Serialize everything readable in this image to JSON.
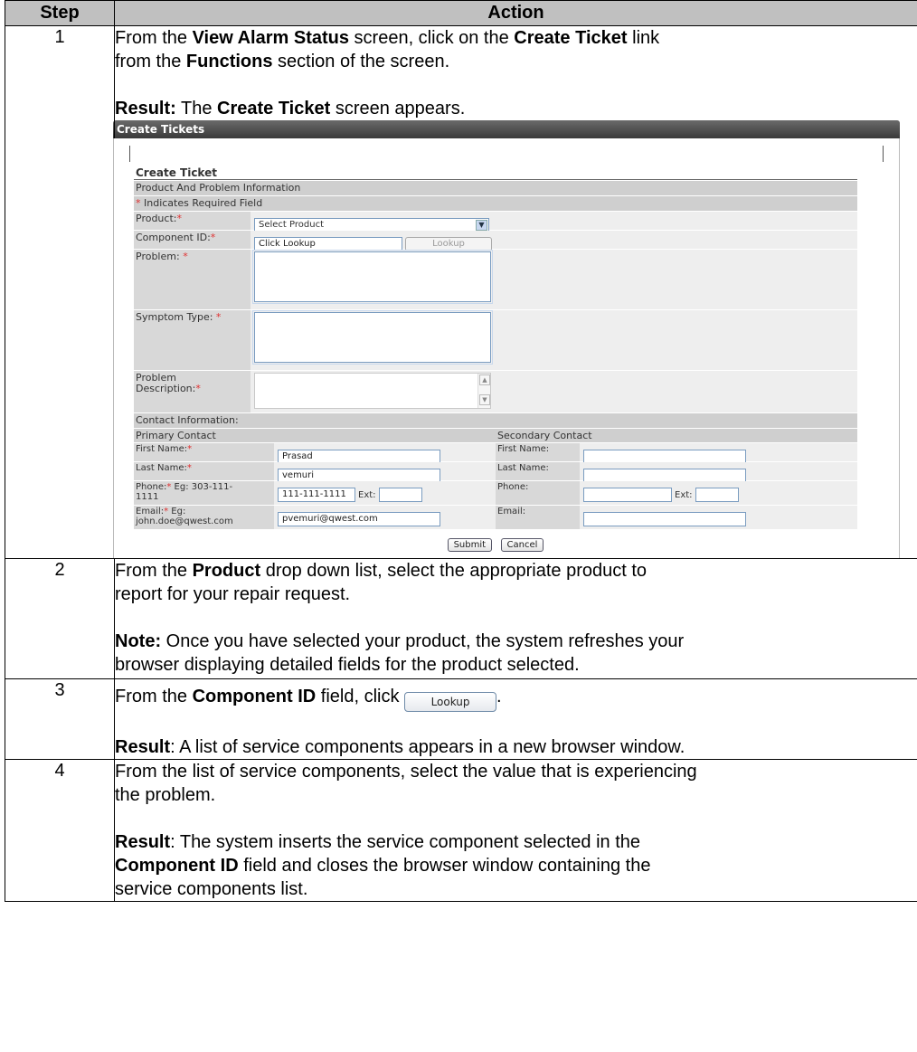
{
  "table": {
    "col_step": "Step",
    "col_action": "Action"
  },
  "steps": [
    {
      "num": "1",
      "line1_a": "From the ",
      "line1_b": "View Alarm Status",
      "line1_c": " screen, click on the ",
      "line1_d": "Create Ticket",
      "line1_e": " link",
      "line2_a": "from the ",
      "line2_b": "Functions",
      "line2_c": " section of the screen.",
      "result_label": "Result:",
      "result_a": " The ",
      "result_b": "Create Ticket",
      "result_c": " screen appears."
    },
    {
      "num": "2",
      "line1_a": "From the ",
      "line1_b": "Product",
      "line1_c": " drop down list, select the appropriate product to",
      "line2": "report for your repair request.",
      "note_label": "Note:",
      "note_text": "  Once you have selected your product, the system refreshes your",
      "note_text2": "browser displaying detailed fields for the product selected."
    },
    {
      "num": "3",
      "line1_a": "From the ",
      "line1_b": "Component ID",
      "line1_c": " field, click ",
      "line1_d": ".",
      "button": "Lookup",
      "result_label": "Result",
      "result_text": ":  A list of service components appears in a new browser window."
    },
    {
      "num": "4",
      "line1": "From the list of service components, select the value that is experiencing",
      "line2": "the problem.",
      "result_label": "Result",
      "result_text": ":  The system inserts the service component selected in the",
      "result_b": "Component ID",
      "result_c": " field and closes the browser window containing the",
      "result_d": "service components list."
    }
  ],
  "screenshot": {
    "window_title": "Create Tickets",
    "form_title": "Create Ticket",
    "section_product": "Product And Problem Information",
    "required_star": "*",
    "required_note": " Indicates Required Field",
    "product_label": "Product:",
    "product_value": "Select Product",
    "component_label": "Component ID:",
    "component_value": "Click Lookup",
    "lookup_button": "Lookup",
    "problem_label": "Problem: ",
    "symptom_label": "Symptom Type: ",
    "desc_label_1": "Problem",
    "desc_label_2": "Description:",
    "section_contact": "Contact Information:",
    "primary_contact": "Primary Contact",
    "secondary_contact": "Secondary Contact",
    "first_name": "First Name:",
    "last_name": "Last Name:",
    "phone_label": "Phone:",
    "phone_eg_1": " Eg: 303-111-",
    "phone_eg_2": "1111",
    "email_label": "Email:",
    "email_eg_1": " Eg:",
    "email_eg_2": "john.doe@qwest.com",
    "first_value": "Prasad",
    "last_value": "vemuri",
    "phone_value": "111-111-1111",
    "ext_label": "Ext:",
    "email_value": "pvemuri@qwest.com",
    "sec_first": "First Name:",
    "sec_last": "Last Name:",
    "sec_phone": "Phone:",
    "sec_email": "Email:",
    "submit": "Submit",
    "cancel": "Cancel",
    "select_arrow": "▼",
    "scroll_up": "▲",
    "scroll_down": "▼"
  }
}
